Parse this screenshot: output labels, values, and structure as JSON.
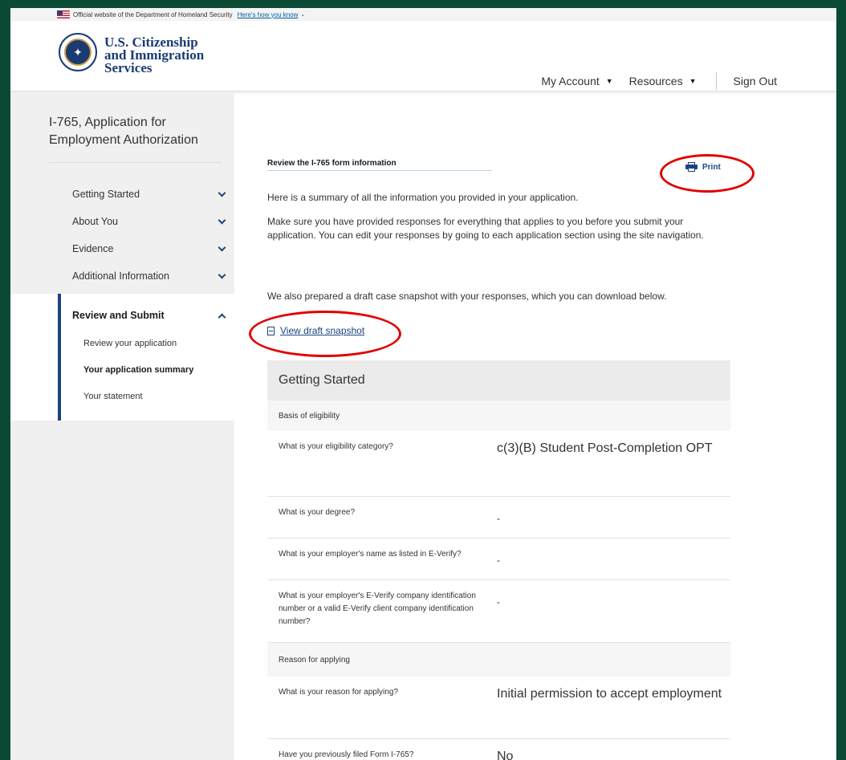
{
  "banner": {
    "text": "Official website of the Department of Homeland Security",
    "link": "Here's how you know"
  },
  "header": {
    "agency_line1": "U.S. Citizenship",
    "agency_line2": "and Immigration",
    "agency_line3": "Services",
    "nav": {
      "my_account": "My Account",
      "resources": "Resources",
      "sign_out": "Sign Out"
    }
  },
  "sidebar": {
    "title": "I-765, Application for Employment Authorization",
    "items": [
      {
        "label": "Getting Started"
      },
      {
        "label": "About You"
      },
      {
        "label": "Evidence"
      },
      {
        "label": "Additional Information"
      }
    ],
    "active": {
      "label": "Review and Submit",
      "subitems": [
        {
          "label": "Review your application"
        },
        {
          "label": "Your application summary"
        },
        {
          "label": "Your statement"
        }
      ]
    }
  },
  "main": {
    "review_title": "Review the I-765 form information",
    "print_label": "Print",
    "para1": "Here is a summary of all the information you provided in your application.",
    "para2": "Make sure you have provided responses for everything that applies to you before you submit your application. You can edit your responses by going to each application section using the site navigation.",
    "para3": "We also prepared a draft case snapshot with your responses, which you can download below.",
    "snapshot_link": "View draft snapshot",
    "summary": {
      "section_title": "Getting Started",
      "group1": "Basis of eligibility",
      "rows1": [
        {
          "q": "What is your eligibility category?",
          "a": "c(3)(B) Student Post-Completion OPT"
        },
        {
          "q": "What is your degree?",
          "a": "-"
        },
        {
          "q": "What is your employer's name as listed in E-Verify?",
          "a": "-"
        },
        {
          "q": "What is your employer's E-Verify company identification number or a valid E-Verify client company identification number?",
          "a": "-"
        }
      ],
      "group2": "Reason for applying",
      "rows2": [
        {
          "q": "What is your reason for applying?",
          "a": "Initial permission to accept employment"
        },
        {
          "q": "Have you previously filed Form I-765?",
          "a": "No"
        }
      ]
    }
  },
  "colors": {
    "outer_background": "#0b4a35",
    "accent_navy": "#1a4480",
    "annotation_red": "#e00000"
  }
}
